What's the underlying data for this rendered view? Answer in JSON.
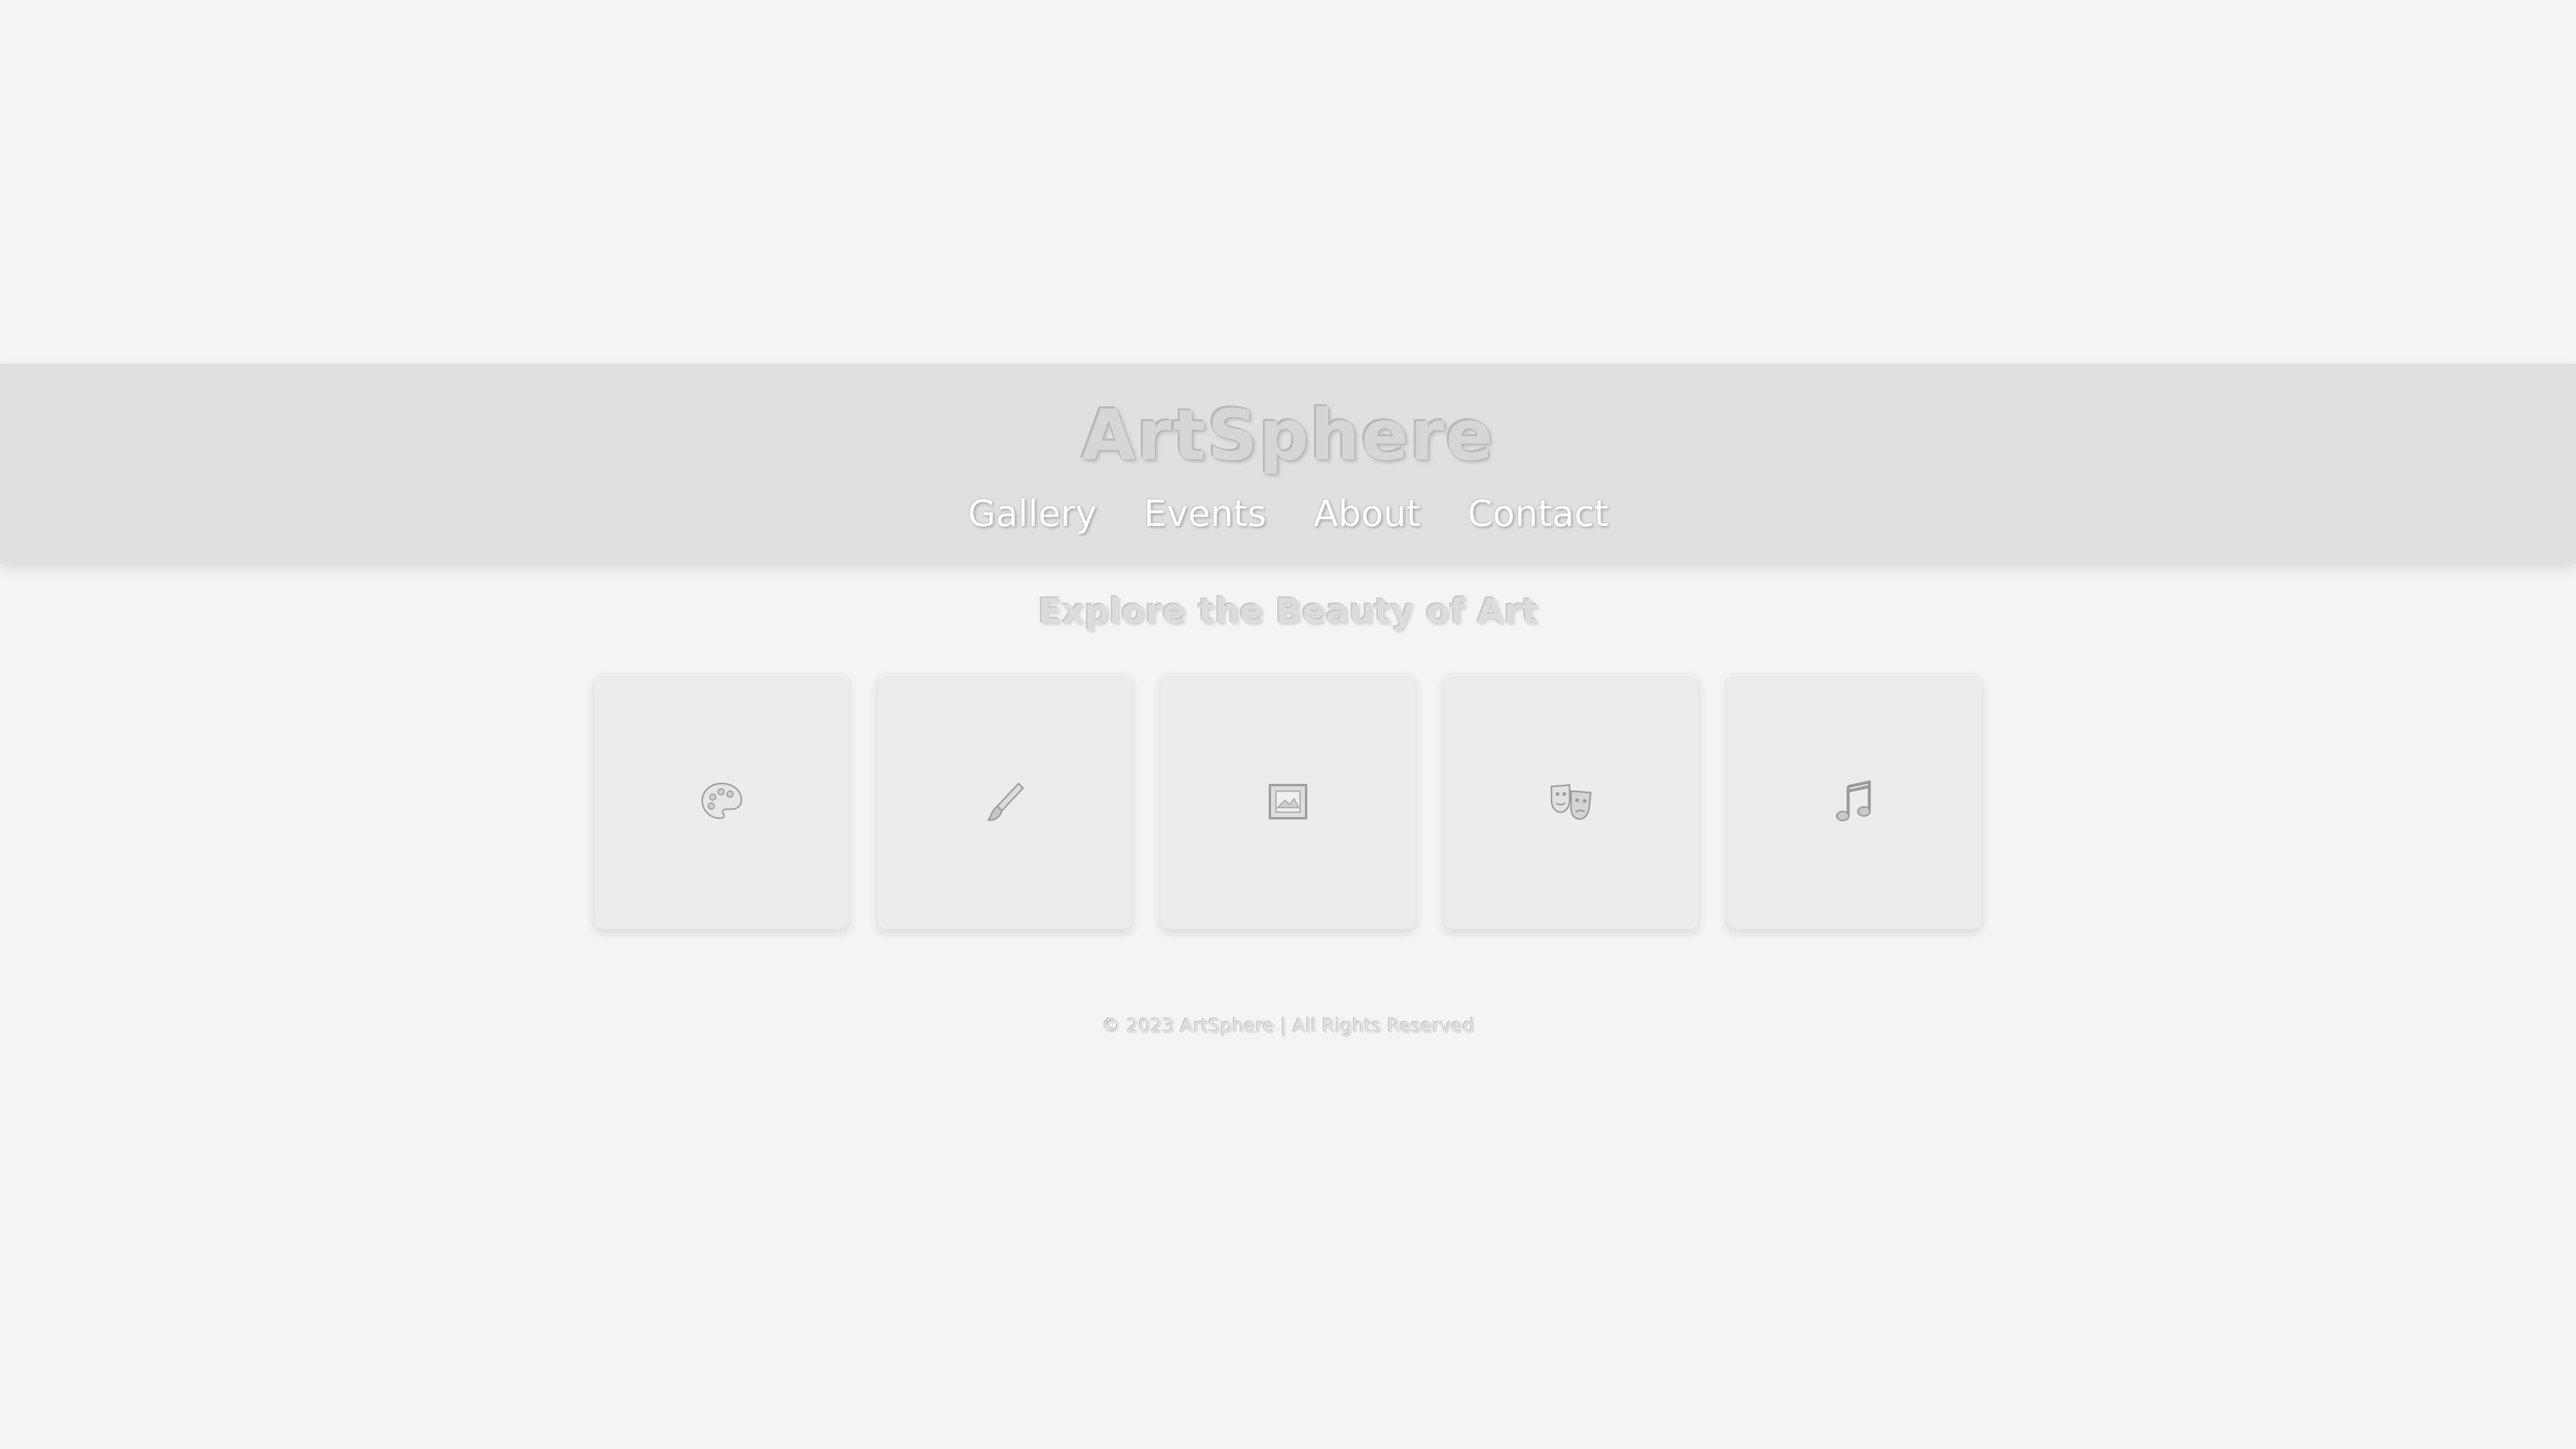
{
  "header": {
    "brand": "ArtSphere",
    "nav": [
      {
        "label": "Gallery"
      },
      {
        "label": "Events"
      },
      {
        "label": "About"
      },
      {
        "label": "Contact"
      }
    ]
  },
  "main": {
    "tagline": "Explore the Beauty of Art",
    "tiles": [
      {
        "icon": "palette-icon"
      },
      {
        "icon": "paintbrush-icon"
      },
      {
        "icon": "framed-picture-icon"
      },
      {
        "icon": "theater-masks-icon"
      },
      {
        "icon": "music-note-icon"
      }
    ]
  },
  "footer": {
    "text": "© 2023 ArtSphere | All Rights Reserved"
  },
  "colors": {
    "background": "#f4f4f4",
    "header_band": "#e0e0e0",
    "tile": "#ececec",
    "nav_text": "#ffffff"
  }
}
